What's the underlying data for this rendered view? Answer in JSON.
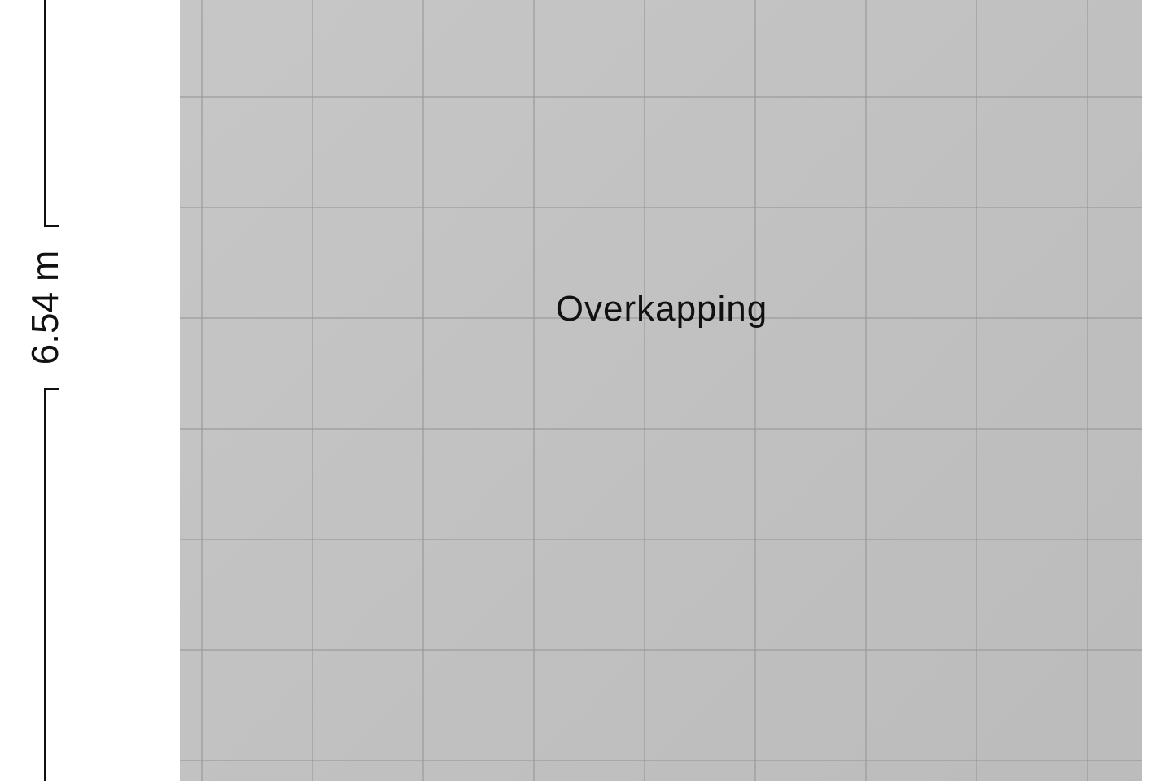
{
  "floorplan": {
    "dimension_label": "6.54 m",
    "room_label": "Overkapping"
  },
  "colors": {
    "floor_fill": "#c3c3c3",
    "tile_grout": "#969696",
    "ink": "#111111",
    "background": "#ffffff"
  }
}
